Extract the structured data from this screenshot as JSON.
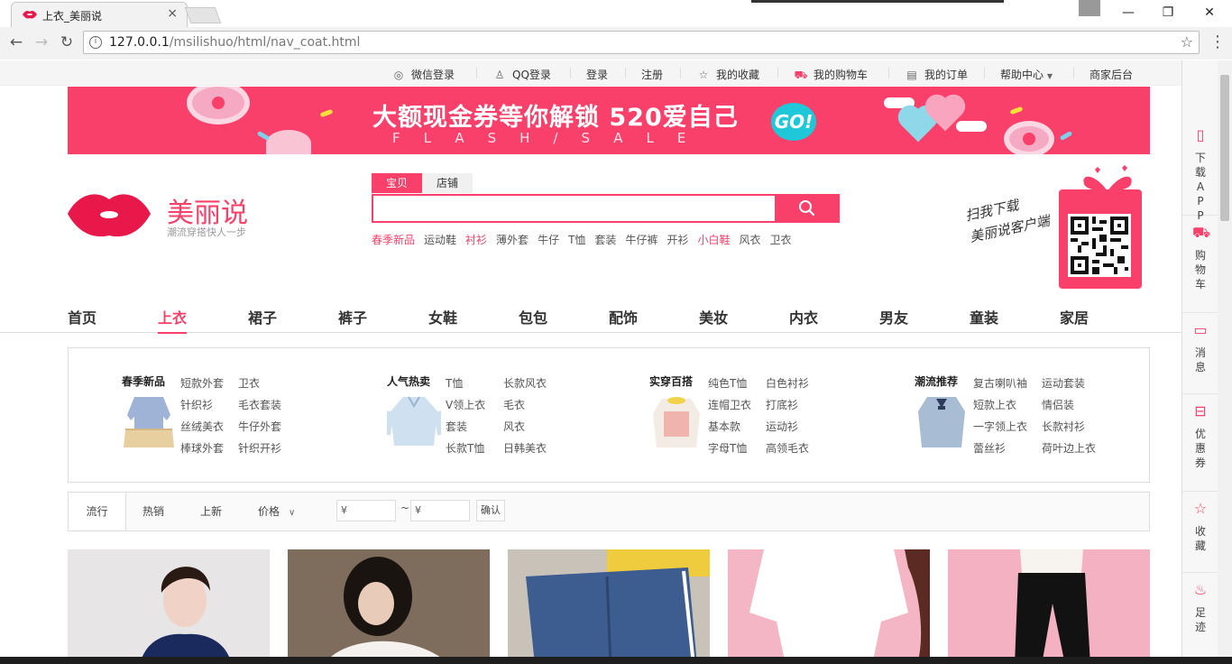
{
  "browser": {
    "tab_title": "上衣_美丽说",
    "url_host": "127.0.0.1",
    "url_path": "/msilishuo/html/nav_coat.html",
    "close_glyph": "×",
    "win_min": "—",
    "win_max": "❐",
    "win_close": "✕"
  },
  "topbar": {
    "items": [
      {
        "label": "微信登录",
        "icon": "wechat-icon"
      },
      {
        "label": "QQ登录",
        "icon": "qq-icon"
      },
      {
        "label": "登录"
      },
      {
        "label": "注册"
      },
      {
        "label": "我的收藏",
        "icon": "star-icon"
      },
      {
        "label": "我的购物车",
        "icon": "cart-icon"
      },
      {
        "label": "我的订单",
        "icon": "order-icon"
      },
      {
        "label": "帮助中心"
      },
      {
        "label": "商家后台"
      }
    ]
  },
  "banner": {
    "headline": "大额现金券等你解锁 520爱自己",
    "subline": "FLASH/SALE",
    "go": "GO!"
  },
  "logo": {
    "brand": "美丽说",
    "slogan": "潮流穿搭快人一步"
  },
  "search": {
    "tabs": [
      "宝贝",
      "店铺"
    ],
    "hot_words": [
      {
        "text": "春季新品",
        "hot": true
      },
      {
        "text": "运动鞋",
        "hot": false
      },
      {
        "text": "衬衫",
        "hot": true
      },
      {
        "text": "薄外套",
        "hot": false
      },
      {
        "text": "牛仔",
        "hot": false
      },
      {
        "text": "T恤",
        "hot": false
      },
      {
        "text": "套装",
        "hot": false
      },
      {
        "text": "牛仔裤",
        "hot": false
      },
      {
        "text": "开衫",
        "hot": false
      },
      {
        "text": "小白鞋",
        "hot": true
      },
      {
        "text": "风衣",
        "hot": false
      },
      {
        "text": "卫衣",
        "hot": false
      }
    ]
  },
  "qr": {
    "caption_line1": "扫我下载",
    "caption_line2": "美丽说客户端"
  },
  "main_nav": {
    "items": [
      "首页",
      "上衣",
      "裙子",
      "裤子",
      "女鞋",
      "包包",
      "配饰",
      "美妆",
      "内衣",
      "男友",
      "童装",
      "家居"
    ],
    "active": "上衣"
  },
  "categories": [
    {
      "title": "春季新品",
      "links": [
        "短款外套",
        "卫衣",
        "针织衫",
        "毛衣套装",
        "丝绒美衣",
        "牛仔外套",
        "棒球外套",
        "针织开衫"
      ]
    },
    {
      "title": "人气热卖",
      "links": [
        "T恤",
        "长款风衣",
        "V领上衣",
        "毛衣",
        "套装",
        "风衣",
        "长款T恤",
        "日韩美衣"
      ]
    },
    {
      "title": "实穿百搭",
      "links": [
        "纯色T恤",
        "白色衬衫",
        "连帽卫衣",
        "打底衫",
        "基本款",
        "运动衫",
        "字母T恤",
        "高领毛衣"
      ]
    },
    {
      "title": "潮流推荐",
      "links": [
        "复古喇叭袖",
        "运动套装",
        "短款上衣",
        "情侣装",
        "一字领上衣",
        "长款衬衫",
        "蕾丝衫",
        "荷叶边上衣"
      ]
    }
  ],
  "sort_bar": {
    "items": [
      "流行",
      "热销",
      "上新",
      "价格"
    ],
    "price_min_placeholder": "¥",
    "price_max_placeholder": "¥",
    "tilde": "~",
    "confirm": "确认"
  },
  "sidebar": {
    "items": [
      {
        "label": "下载APP",
        "icon": "phone-icon"
      },
      {
        "label": "购物车",
        "icon": "cart-icon"
      },
      {
        "label": "消息",
        "icon": "message-icon"
      },
      {
        "label": "优惠券",
        "icon": "coupon-icon"
      },
      {
        "label": "收藏",
        "icon": "star-icon"
      },
      {
        "label": "足迹",
        "icon": "footprint-icon"
      }
    ]
  },
  "colors": {
    "brand": "#f8406a",
    "banner_bg": "#f8406a"
  }
}
